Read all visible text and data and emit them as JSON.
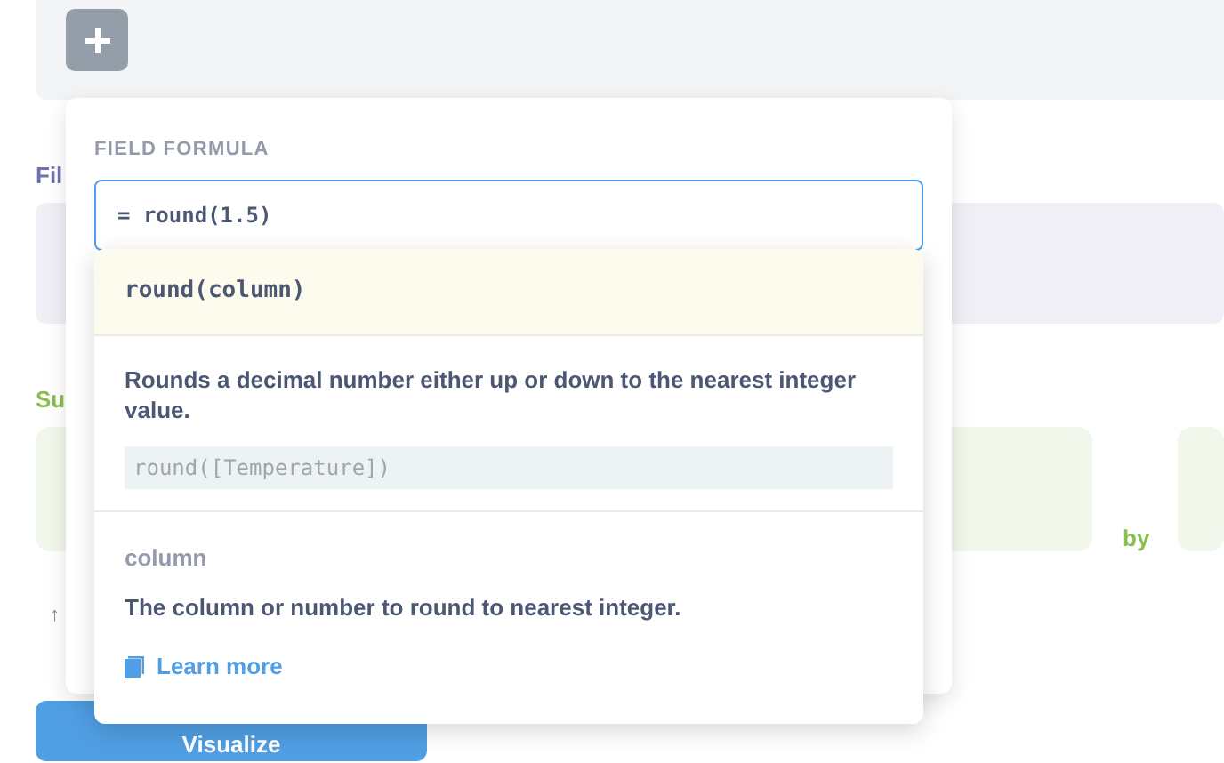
{
  "background": {
    "filter_label": "Fil",
    "summarize_label": "Su",
    "by_label": "by",
    "sort_icon_text": "↑",
    "visualize_button": "Visualize"
  },
  "formula_popover": {
    "title": "FIELD FORMULA",
    "value": "= round(1.5)"
  },
  "help_popover": {
    "signature": "round(column)",
    "description": "Rounds a decimal number either up or down to the nearest integer value.",
    "example": "round([Temperature])",
    "argument_name": "column",
    "argument_description": "The column or number to round to nearest integer.",
    "link": "Learn more"
  }
}
